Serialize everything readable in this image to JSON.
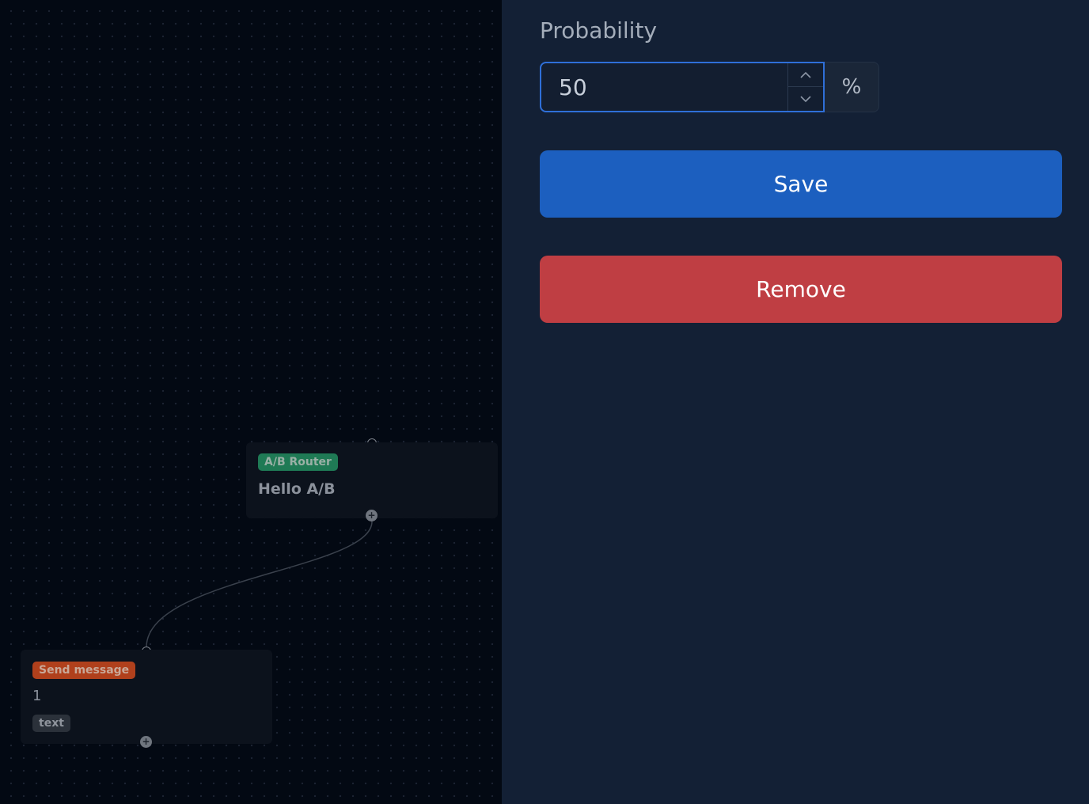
{
  "canvas": {
    "router_node": {
      "badge": "A/B Router",
      "title": "Hello A/B"
    },
    "send_node": {
      "badge": "Send message",
      "text": "1",
      "tag": "text"
    },
    "handle_out_glyph": "+"
  },
  "panel": {
    "probability_label": "Probability",
    "probability_value": "50",
    "unit": "%",
    "save_label": "Save",
    "remove_label": "Remove"
  },
  "colors": {
    "panel_bg": "#132035",
    "canvas_bg": "#030913",
    "save": "#1c5fbf",
    "remove": "#bf3e43",
    "focus_border": "#2f6fd8",
    "router_badge": "#1f7a55",
    "send_badge": "#b0401c"
  },
  "icons": {
    "step_up": "chevron-up-icon",
    "step_down": "chevron-down-icon",
    "output_handle": "plus-icon"
  }
}
